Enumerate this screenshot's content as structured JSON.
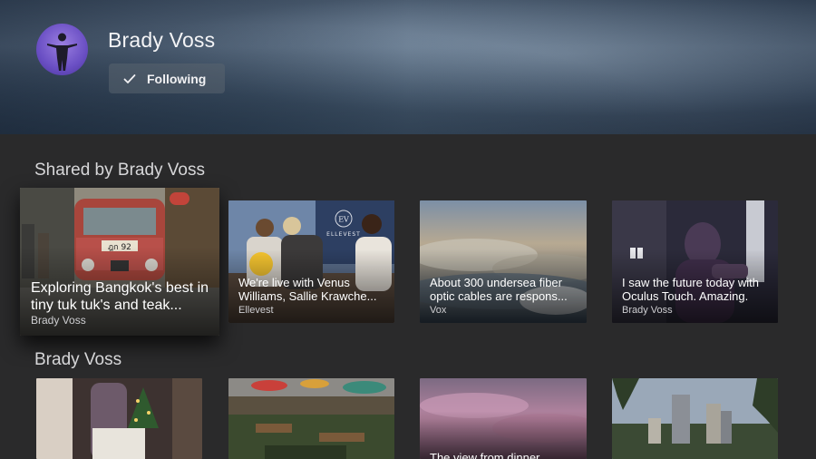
{
  "profile": {
    "name": "Brady Voss",
    "follow_label": "Following"
  },
  "sections": [
    {
      "title": "Shared by Brady Voss",
      "items": [
        {
          "title": "Exploring Bangkok's best in tiny tuk tuk's and teak...",
          "source": "Brady Voss",
          "plate_text": "ฎก 92"
        },
        {
          "title": "We're live with Venus Williams, Sallie Krawche...",
          "source": "Ellevest",
          "logo_text": "ELLEVEST",
          "logo_mono": "EV"
        },
        {
          "title": "About 300 undersea fiber optic cables are respons...",
          "source": "Vox"
        },
        {
          "title": "I saw the future today with Oculus Touch. Amazing.",
          "source": "Brady Voss"
        }
      ]
    },
    {
      "title": "Brady Voss",
      "items": [
        {
          "title": ""
        },
        {
          "title": ""
        },
        {
          "title": "The view from dinner"
        },
        {
          "title": ""
        }
      ]
    }
  ],
  "colors": {
    "background": "#2a2a2b",
    "header": "#4a5d73",
    "avatar": "#7b5fd4",
    "button": "#5a6470"
  }
}
